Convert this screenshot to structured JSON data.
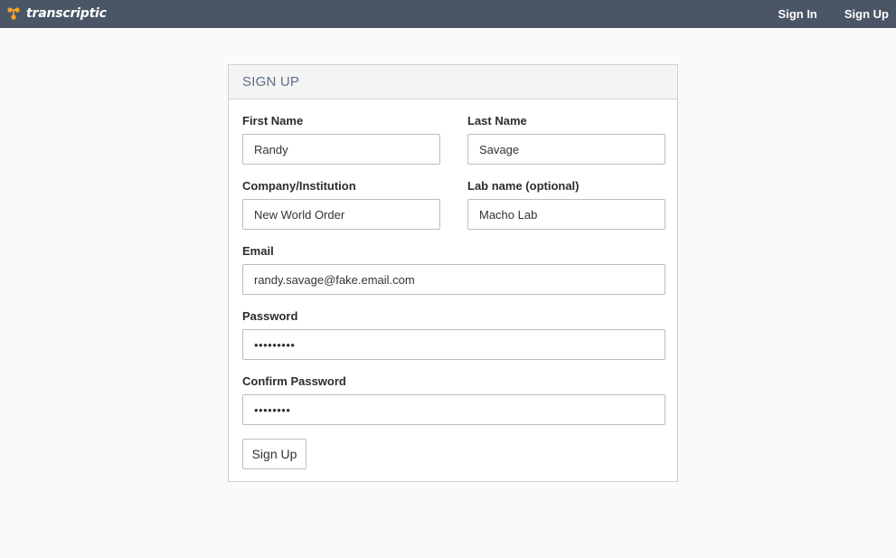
{
  "header": {
    "brand_name": "transcriptic",
    "logo_icon": "transcriptic-logo-icon",
    "nav": {
      "sign_in": "Sign In",
      "sign_up": "Sign Up"
    }
  },
  "form": {
    "title": "SIGN UP",
    "first_name": {
      "label": "First Name",
      "value": "Randy"
    },
    "last_name": {
      "label": "Last Name",
      "value": "Savage"
    },
    "company": {
      "label": "Company/Institution",
      "value": "New World Order"
    },
    "lab_name": {
      "label": "Lab name (optional)",
      "value": "Macho Lab"
    },
    "email": {
      "label": "Email",
      "value": "randy.savage@fake.email.com"
    },
    "password": {
      "label": "Password",
      "value": "•••••••••"
    },
    "confirm_password": {
      "label": "Confirm Password",
      "value": "••••••••"
    },
    "submit_label": "Sign Up"
  },
  "colors": {
    "topbar_bg": "#4a5566",
    "logo_accent": "#f5a623",
    "panel_title": "#5b6e86"
  }
}
